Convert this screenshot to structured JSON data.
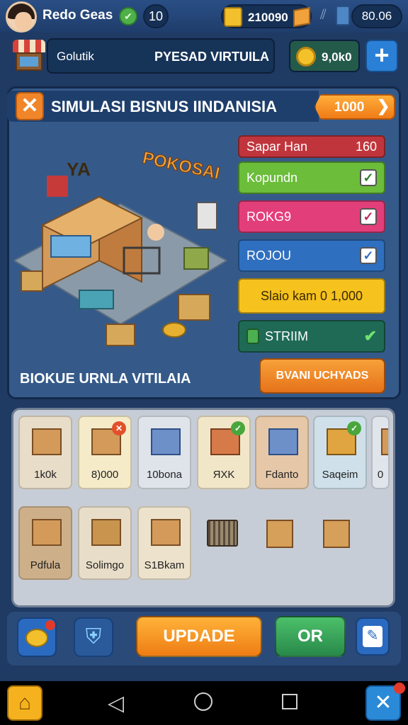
{
  "status": {
    "player_name": "Redo Geas",
    "level": "10",
    "gold": "210090",
    "gems": "80.06"
  },
  "header": {
    "shop_label": "Golutik",
    "mode_title": "PYESAD VIRTUILA",
    "coin_amount": "9,0k0"
  },
  "panel": {
    "title": "SIMULASI BISNUS IINDANISIA",
    "cost": "1000",
    "scene_caption": "BIOKUE URNLA VITILAIA",
    "scene_sign": "POKOSAI",
    "store_sign": "YA"
  },
  "options": [
    {
      "label": "Sapar Han",
      "value": "160",
      "color": "#c0353c"
    },
    {
      "label": "Kopundn",
      "color": "#6bbd3a"
    },
    {
      "label": "ROKG9",
      "color": "#e23e7a"
    },
    {
      "label": "ROJOU",
      "color": "#2f6fbf"
    },
    {
      "label": "Slaio kam 0 1,000",
      "color": "#f6c21d"
    },
    {
      "label": "STRIIM",
      "color": "#1f6a55"
    }
  ],
  "confirm_button": "BVANI UCHYADS",
  "inventory": {
    "row1": [
      {
        "label": "1k0k",
        "bg": "#e8ddc8"
      },
      {
        "label": "8)000",
        "bg": "#f5ebc9",
        "badge": "x"
      },
      {
        "label": "10bona",
        "bg": "#dfe3ea"
      },
      {
        "label": "ЯXK",
        "bg": "#f2e6c8",
        "badge": "check"
      },
      {
        "label": "Fdanto",
        "bg": "#e6c8a8"
      },
      {
        "label": "Saqeim",
        "bg": "#cfe0ea",
        "badge": "check"
      },
      {
        "label": "0",
        "bg": "#e0e5ec"
      }
    ],
    "row2": [
      {
        "label": "Pdfula",
        "bg": "#cdb08a"
      },
      {
        "label": "Solimgo",
        "bg": "#e8ddc8"
      },
      {
        "label": "S1Bkam",
        "bg": "#ede3cc"
      }
    ]
  },
  "actions": {
    "update": "UPDADE",
    "ok": "OR"
  }
}
